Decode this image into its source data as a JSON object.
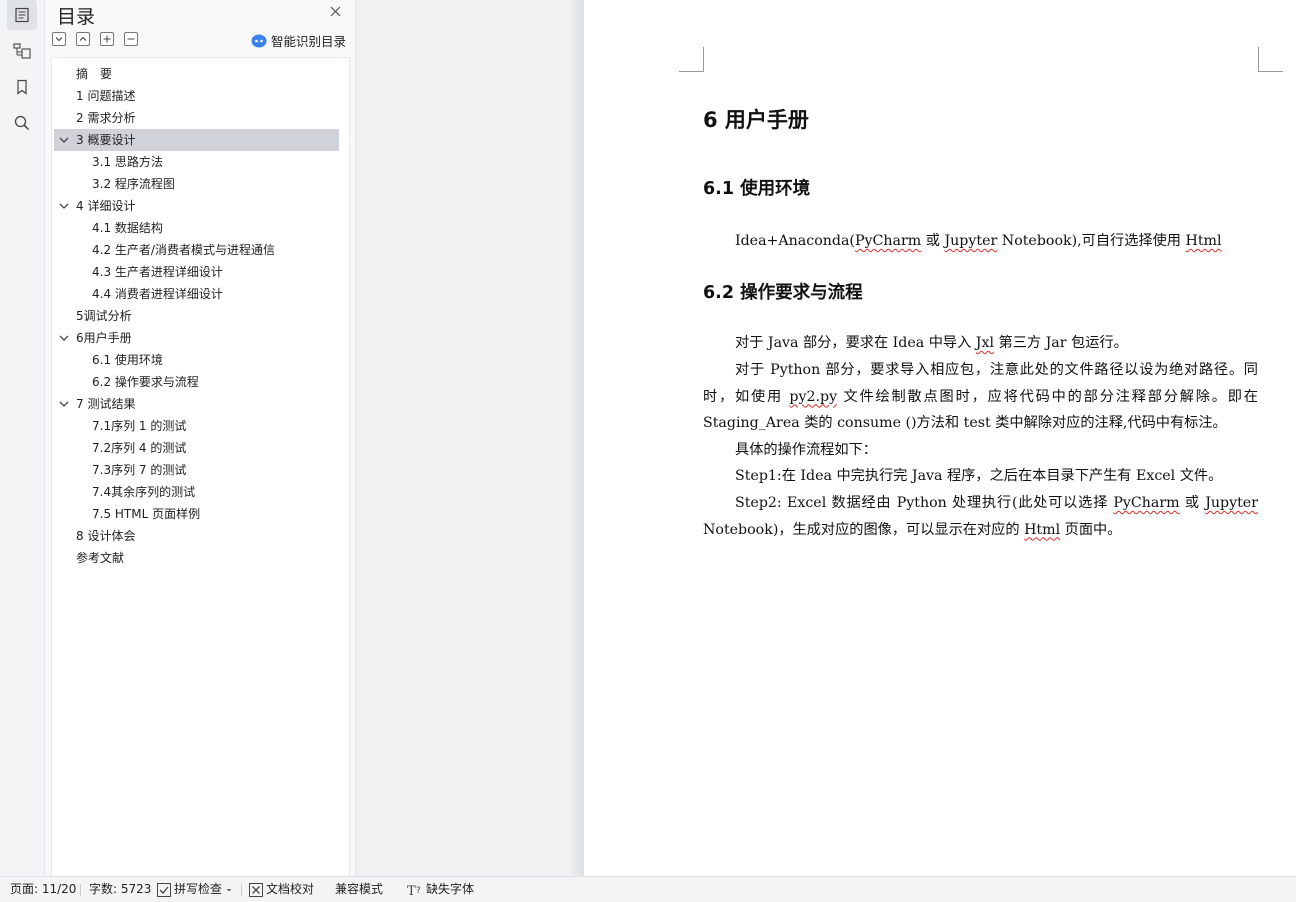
{
  "panel": {
    "title": "目录",
    "smart_toc_label": "智能识别目录"
  },
  "toc": [
    {
      "label": "摘　要",
      "level": 1,
      "expandable": false,
      "selected": false
    },
    {
      "label": "1  问题描述",
      "level": 1,
      "expandable": false,
      "selected": false
    },
    {
      "label": "2  需求分析",
      "level": 1,
      "expandable": false,
      "selected": false
    },
    {
      "label": "3  概要设计",
      "level": 1,
      "expandable": true,
      "selected": true
    },
    {
      "label": "3.1  思路方法",
      "level": 2,
      "expandable": false,
      "selected": false
    },
    {
      "label": "3.2  程序流程图",
      "level": 2,
      "expandable": false,
      "selected": false
    },
    {
      "label": "4  详细设计",
      "level": 1,
      "expandable": true,
      "selected": false
    },
    {
      "label": "4.1  数据结构",
      "level": 2,
      "expandable": false,
      "selected": false
    },
    {
      "label": "4.2  生产者/消费者模式与进程通信",
      "level": 2,
      "expandable": false,
      "selected": false
    },
    {
      "label": "4.3  生产者进程详细设计",
      "level": 2,
      "expandable": false,
      "selected": false
    },
    {
      "label": "4.4  消费者进程详细设计",
      "level": 2,
      "expandable": false,
      "selected": false
    },
    {
      "label": "5调试分析",
      "level": 1,
      "expandable": false,
      "selected": false
    },
    {
      "label": "6用户手册",
      "level": 1,
      "expandable": true,
      "selected": false
    },
    {
      "label": "6.1  使用环境",
      "level": 2,
      "expandable": false,
      "selected": false
    },
    {
      "label": "6.2  操作要求与流程",
      "level": 2,
      "expandable": false,
      "selected": false
    },
    {
      "label": "7  测试结果",
      "level": 1,
      "expandable": true,
      "selected": false
    },
    {
      "label": "7.1序列 1 的测试",
      "level": 2,
      "expandable": false,
      "selected": false
    },
    {
      "label": "7.2序列 4 的测试",
      "level": 2,
      "expandable": false,
      "selected": false
    },
    {
      "label": "7.3序列 7 的测试",
      "level": 2,
      "expandable": false,
      "selected": false
    },
    {
      "label": "7.4其余序列的测试",
      "level": 2,
      "expandable": false,
      "selected": false
    },
    {
      "label": "7.5  HTML 页面样例",
      "level": 2,
      "expandable": false,
      "selected": false
    },
    {
      "label": "8  设计体会",
      "level": 1,
      "expandable": false,
      "selected": false
    },
    {
      "label": "参考文献",
      "level": 1,
      "expandable": false,
      "selected": false
    }
  ],
  "document": {
    "h1": "6  用户手册",
    "h2_1": "6.1    使用环境",
    "h2_2": "6.2    操作要求与流程",
    "p_env": {
      "a": "Idea+Anaconda(",
      "b": "PyCharm",
      "c": " 或 ",
      "d": "Jupyter",
      "e": " Notebook),可自行选择使用 ",
      "f": "Html"
    },
    "p1": {
      "a": "对于 Java 部分，要求在 Idea 中导入 ",
      "b": "Jxl",
      "c": " 第三方 Jar 包运行。"
    },
    "p2": {
      "a": "对于 Python 部分，要求导入相应包，注意此处的文件路径以设为绝对路径。同时，如使用 ",
      "b": "py2.py",
      "c": " 文件绘制散点图时，应将代码中的部分注释部分解除。即在 Staging_Area 类的 consume ()方法和 test 类中解除对应的注释,代码中有标注。"
    },
    "p3": "具体的操作流程如下：",
    "p4": "Step1:在 Idea 中完执行完 Java 程序，之后在本目录下产生有 Excel 文件。",
    "p5": {
      "a": "Step2: Excel 数据经由 Python 处理执行(此处可以选择 ",
      "b": "PyCharm",
      "c": " 或 ",
      "d": "Jupyter",
      "e": " Notebook)，生成对应的图像，可以显示在对应的 ",
      "f": "Html",
      "g": " 页面中。"
    }
  },
  "status": {
    "page": "页面: 11/20",
    "words": "字数: 5723",
    "spell": "拼写检查",
    "proof": "文档校对",
    "compat": "兼容模式",
    "missing_font": "缺失字体"
  },
  "colors": {
    "accent": "#3b82e8",
    "selected_row": "#cfd3d9",
    "squiggle": "#d9302c"
  }
}
